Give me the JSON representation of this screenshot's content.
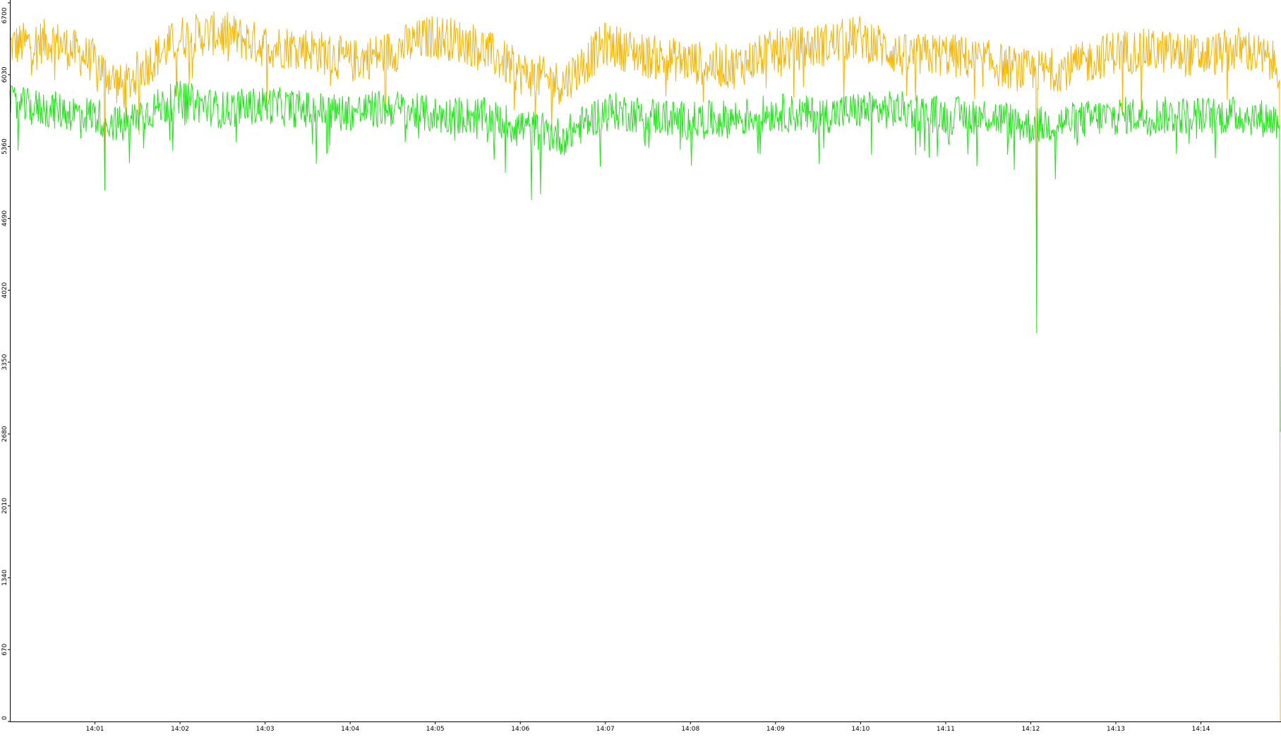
{
  "chart_data": {
    "type": "line",
    "title": "",
    "xlabel": "",
    "ylabel": "",
    "grid": false,
    "legend": "none",
    "ylim": [
      0,
      6700
    ],
    "xlim": [
      "14:00:00",
      "14:14:56"
    ],
    "y_ticks": [
      "0",
      "670",
      "1340",
      "2010",
      "2680",
      "3350",
      "4020",
      "4690",
      "5360",
      "6030",
      "6700"
    ],
    "x_ticks": [
      {
        "label": "14:01",
        "t": "14:01:00"
      },
      {
        "label": "14:02",
        "t": "14:02:00"
      },
      {
        "label": "14:03",
        "t": "14:03:00"
      },
      {
        "label": "14:04",
        "t": "14:04:00"
      },
      {
        "label": "14:05",
        "t": "14:05:00"
      },
      {
        "label": "14:06",
        "t": "14:06:00"
      },
      {
        "label": "14:07",
        "t": "14:07:00"
      },
      {
        "label": "14:08",
        "t": "14:08:00"
      },
      {
        "label": "14:09",
        "t": "14:09:00"
      },
      {
        "label": "14:10",
        "t": "14:10:00"
      },
      {
        "label": "14:11",
        "t": "14:11:00"
      },
      {
        "label": "14:12",
        "t": "14:12:00"
      },
      {
        "label": "14:13",
        "t": "14:13:00"
      },
      {
        "label": "14:14",
        "t": "14:14:00"
      }
    ],
    "series": [
      {
        "color": "#f5b400",
        "x": [
          "14:00:00",
          "14:00:30",
          "14:01:00",
          "14:01:20",
          "14:01:30",
          "14:02:00",
          "14:02:30",
          "14:03:00",
          "14:03:30",
          "14:04:00",
          "14:04:30",
          "14:05:00",
          "14:05:30",
          "14:06:00",
          "14:06:30",
          "14:07:00",
          "14:07:30",
          "14:08:00",
          "14:08:30",
          "14:09:00",
          "14:09:30",
          "14:10:00",
          "14:10:30",
          "14:11:00",
          "14:11:30",
          "14:12:00",
          "14:12:30",
          "14:13:00",
          "14:13:30",
          "14:14:00",
          "14:14:30",
          "14:14:56"
        ],
        "y": [
          6300,
          6350,
          6150,
          5900,
          6050,
          6380,
          6420,
          6300,
          6280,
          6150,
          6250,
          6400,
          6300,
          6050,
          5950,
          6320,
          6200,
          6150,
          6100,
          6250,
          6300,
          6380,
          6200,
          6220,
          6150,
          6050,
          6100,
          6250,
          6250,
          6200,
          6280,
          6100
        ]
      },
      {
        "color": "#22e31a",
        "x": [
          "14:00:00",
          "14:00:30",
          "14:01:00",
          "14:01:20",
          "14:01:30",
          "14:02:00",
          "14:02:30",
          "14:03:00",
          "14:03:30",
          "14:04:00",
          "14:04:30",
          "14:05:00",
          "14:05:30",
          "14:06:00",
          "14:06:30",
          "14:07:00",
          "14:07:30",
          "14:08:00",
          "14:08:30",
          "14:09:00",
          "14:09:30",
          "14:10:00",
          "14:10:30",
          "14:11:00",
          "14:11:30",
          "14:12:00",
          "14:12:30",
          "14:13:00",
          "14:13:30",
          "14:14:00",
          "14:14:30",
          "14:14:56"
        ],
        "y": [
          5750,
          5700,
          5650,
          5550,
          5650,
          5800,
          5700,
          5750,
          5700,
          5680,
          5720,
          5650,
          5650,
          5550,
          5450,
          5700,
          5650,
          5600,
          5620,
          5680,
          5650,
          5700,
          5700,
          5650,
          5650,
          5550,
          5600,
          5650,
          5650,
          5650,
          5650,
          5600
        ]
      }
    ],
    "spikes": [
      {
        "t": "14:01:07",
        "series": 0,
        "y": 5100
      },
      {
        "t": "14:01:07",
        "series": 1,
        "y": 4950
      },
      {
        "t": "14:06:08",
        "series": 1,
        "y": 4860
      },
      {
        "t": "14:12:04",
        "series": 0,
        "y": 3950
      },
      {
        "t": "14:12:04",
        "series": 1,
        "y": 3620
      },
      {
        "t": "14:14:56",
        "series": 0,
        "y": 0
      },
      {
        "t": "14:14:56",
        "series": 1,
        "y": 2700
      }
    ]
  }
}
